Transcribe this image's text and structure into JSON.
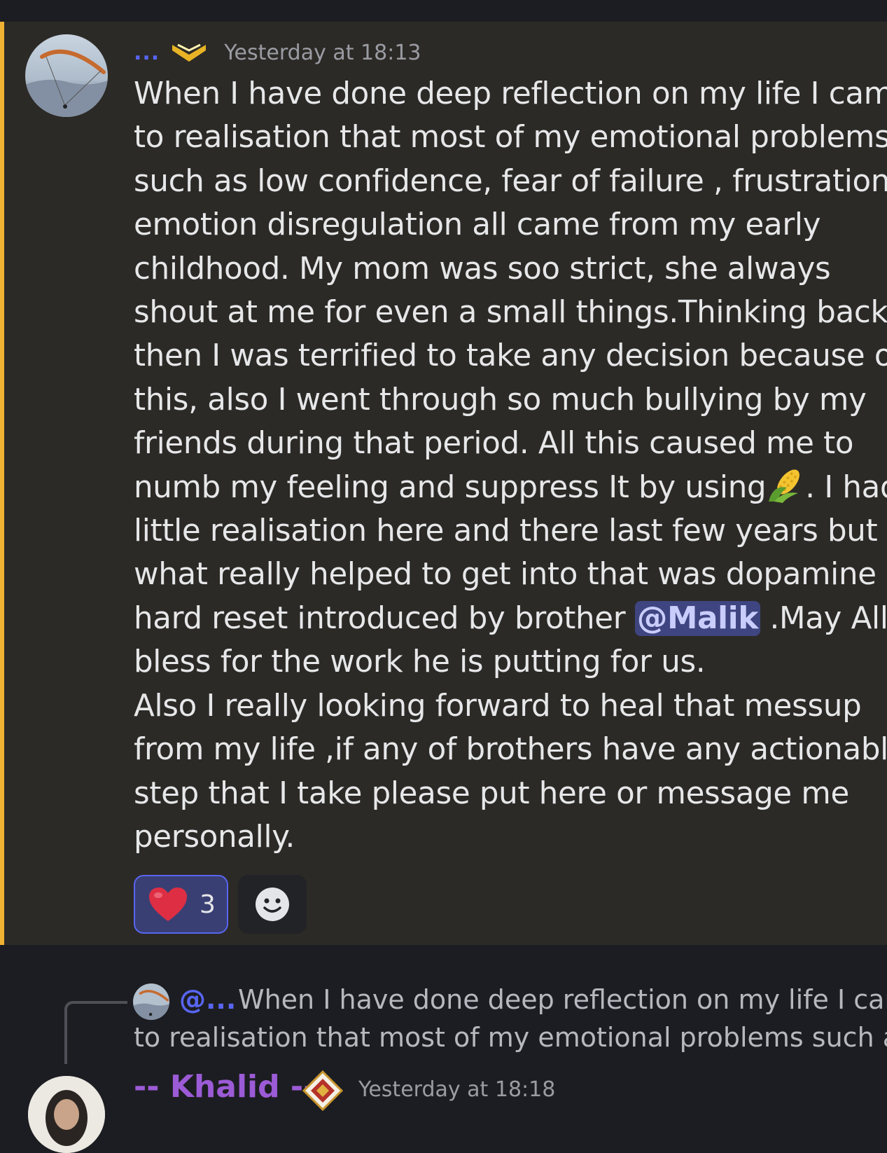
{
  "message": {
    "username": "...",
    "timestamp": "Yesterday at 18:13",
    "lines": [
      "When I have done deep reflection on my life I came",
      "to realisation that most of my emotional problems",
      "such as low confidence, fear of failure , frustration,",
      "emotion disregulation all came from my early",
      "childhood. My mom was soo strict, she always",
      "shout at me for even a small things.Thinking back",
      "then I was terrified to take any decision because of",
      "this, also I went through so much bullying by my",
      "friends during that period. All this  caused me to"
    ],
    "line10_before": "numb my feeling and suppress It by using",
    "line10_after": ". I had",
    "lines_b": [
      "little realisation here and there last few years but",
      "what really helped to get into that was dopamine"
    ],
    "line13_before": "hard reset introduced by brother ",
    "mention": "@Malik",
    "line13_after": " .May Allah",
    "lines_c": [
      "bless for the work he is putting for us.",
      "Also I really looking forward to heal that messup",
      "from my life ,if any of brothers have any actionable",
      "step that I take please put here or message me",
      "personally."
    ],
    "reactions": {
      "heart_count": "3"
    },
    "accent_color": "#f0b232"
  },
  "reply": {
    "name": "@...",
    "line1": "When I have done deep reflection on my life I came",
    "line2": "to realisation that most of my emotional problems such a..."
  },
  "next": {
    "username": "-- Khalid --",
    "timestamp": "Yesterday at 18:18"
  },
  "icons": {
    "badge": "chevron-badge-icon",
    "corn": "corn-emoji",
    "heart": "heart-emoji",
    "add_reaction": "smiley-icon"
  }
}
